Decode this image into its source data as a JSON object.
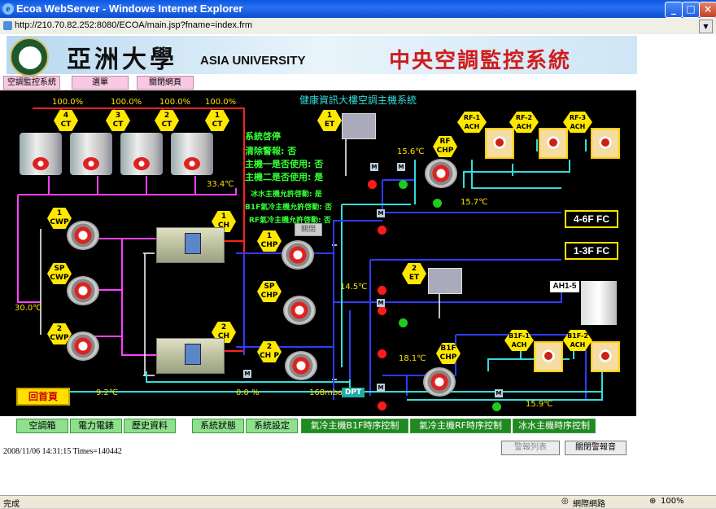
{
  "window": {
    "title": "Ecoa WebServer - Windows Internet Explorer",
    "url": "http://210.70.82.252:8080/ECOA/main.jsp?fname=index.frm"
  },
  "banner": {
    "university_cn": "亞洲大學",
    "university_en": "ASIA UNIVERSITY",
    "system_title": "中央空調監控系統"
  },
  "topnav": [
    "空調監控系統",
    "選單",
    "關閉網頁"
  ],
  "diagram": {
    "title": "健康資訊大樓空調主機系統",
    "status_title": "系統啓停",
    "reset_button": "關閉",
    "status_lines": [
      "清除警報: 否",
      "主機一是否使用: 否",
      "主機二是否使用: 是"
    ],
    "permit_lines": [
      "冰水主機允許啓動: 是",
      "B1F氣冷主機允許啓動: 否",
      "RF氣冷主機允許啓動: 否"
    ],
    "ct_percents": [
      "100.0%",
      "100.0%",
      "100.0%",
      "100.0%"
    ],
    "ct_labels": [
      [
        "4",
        "CT"
      ],
      [
        "3",
        "CT"
      ],
      [
        "2",
        "CT"
      ],
      [
        "1",
        "CT"
      ]
    ],
    "temps": {
      "ct_out": "33.4℃",
      "cw": "30.0℃",
      "rf_top": "15.6℃",
      "rf_bottom": "15.7℃",
      "chw": "14.5℃",
      "b1f": "18.1℃",
      "b1f_bottom": "15.9℃",
      "chw_return": "9.2℃"
    },
    "readouts": {
      "valve_pct": "0.0 %",
      "pressure": "168mbar",
      "dpt": "DPT"
    },
    "fc_labels": [
      "4-6F FC",
      "1-3F FC"
    ],
    "ah_label": "AH1-5",
    "home_button": "回首頁",
    "equipment": {
      "cwp": [
        [
          "1",
          "CWP"
        ],
        [
          "SP",
          "CWP"
        ],
        [
          "2",
          "CWP"
        ]
      ],
      "ch": [
        [
          "1",
          "CH"
        ],
        [
          "2",
          "CH"
        ]
      ],
      "chp": [
        [
          "1",
          "CHP"
        ],
        [
          "SP",
          "CHP"
        ],
        [
          "2",
          "CH P"
        ]
      ],
      "et": [
        [
          "1",
          "ET"
        ],
        [
          "2",
          "ET"
        ]
      ],
      "rf_chp": [
        "RF",
        "CHP"
      ],
      "b1f_chp": [
        "B1F",
        "CHP"
      ],
      "rf_ach": [
        [
          "RF-1",
          "ACH"
        ],
        [
          "RF-2",
          "ACH"
        ],
        [
          "RF-3",
          "ACH"
        ]
      ],
      "b1f_ach": [
        [
          "B1F-1",
          "ACH"
        ],
        [
          "B1F-2",
          "ACH"
        ]
      ]
    }
  },
  "bottomnav": [
    "空調箱",
    "電力電錶",
    "歷史資料",
    "系統狀態",
    "系統設定",
    "氣冷主機B1F時序控制",
    "氣冷主機RF時序控制",
    "冰水主機時序控制"
  ],
  "footer": {
    "timestamp": "2008/11/06 14:31:15 Times=140442",
    "alarm_list": "警報列表",
    "close_alarm_sound": "關閉警報音"
  },
  "statusbar": {
    "left": "完成",
    "zone": "網際網路",
    "zoom": "100%"
  },
  "colors": {
    "panel_bg": "#000000",
    "pipe_red": "#ff2020",
    "pipe_magenta": "#ff40ff",
    "pipe_blue": "#2d3cff",
    "pipe_cyan": "#33dddd",
    "accent_yellow": "#ffe000",
    "text_green": "#33ff33"
  }
}
